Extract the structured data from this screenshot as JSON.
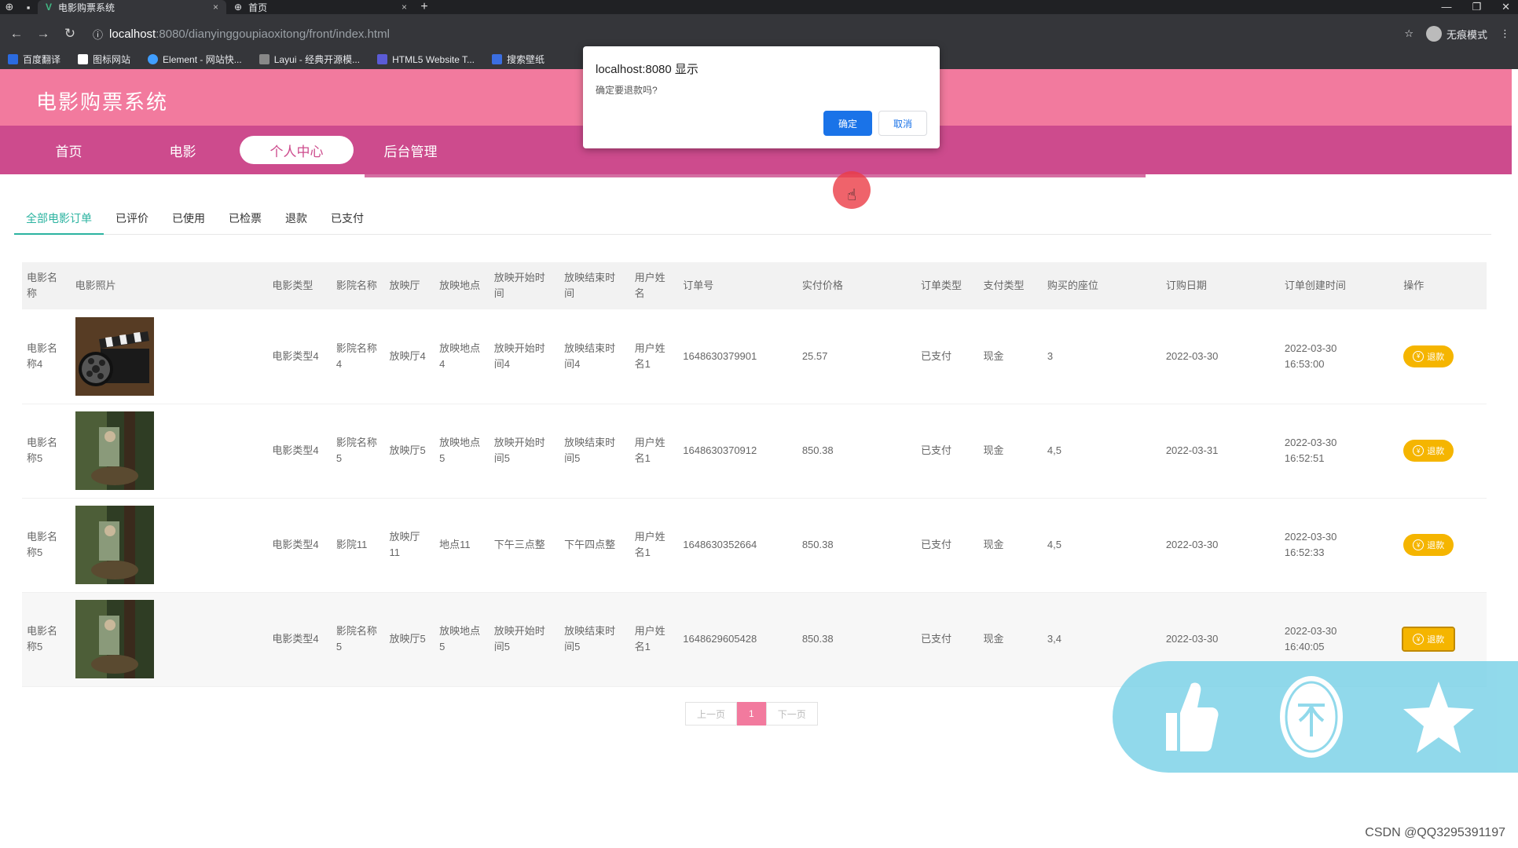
{
  "browser": {
    "tabs": [
      {
        "title": "电影购票系统",
        "close": "×"
      },
      {
        "title": "首页",
        "close": "×"
      }
    ],
    "new_tab": "+",
    "url_host": "localhost",
    "url_path": ":8080/dianyinggoupiaoxitong/front/index.html",
    "incognito_label": "无痕模式",
    "bookmarks": [
      {
        "label": "百度翻译",
        "color": "#2b6be0"
      },
      {
        "label": "图标网站",
        "color": "#ffffff"
      },
      {
        "label": "Element - 网站快...",
        "color": "#409eff"
      },
      {
        "label": "Layui - 经典开源模...",
        "color": "#888888"
      },
      {
        "label": "HTML5 Website T...",
        "color": "#5b5bd6"
      },
      {
        "label": "搜索壁纸",
        "color": "#3b6ee0"
      }
    ]
  },
  "site": {
    "title": "电影购票系统",
    "nav": [
      "首页",
      "电影",
      "个人中心",
      "后台管理"
    ],
    "active_nav": 2
  },
  "order_tabs": [
    "全部电影订单",
    "已评价",
    "已使用",
    "已检票",
    "退款",
    "已支付"
  ],
  "table": {
    "headers": [
      "电影名称",
      "电影照片",
      "电影类型",
      "影院名称",
      "放映厅",
      "放映地点",
      "放映开始时间",
      "放映结束时间",
      "用户姓名",
      "订单号",
      "实付价格",
      "订单类型",
      "支付类型",
      "购买的座位",
      "订购日期",
      "订单创建时间",
      "操作"
    ],
    "rows": [
      {
        "name": "电影名称4",
        "type": "电影类型4",
        "cinema": "影院名称4",
        "hall": "放映厅4",
        "place": "放映地点4",
        "start": "放映开始时间4",
        "end": "放映结束时间4",
        "user": "用户姓名1",
        "order_no": "1648630379901",
        "price": "25.57",
        "order_type": "已支付",
        "pay_type": "现金",
        "seats": "3",
        "date": "2022-03-30",
        "created": "2022-03-30 16:53:00",
        "action": "退款"
      },
      {
        "name": "电影名称5",
        "type": "电影类型4",
        "cinema": "影院名称5",
        "hall": "放映厅5",
        "place": "放映地点5",
        "start": "放映开始时间5",
        "end": "放映结束时间5",
        "user": "用户姓名1",
        "order_no": "1648630370912",
        "price": "850.38",
        "order_type": "已支付",
        "pay_type": "现金",
        "seats": "4,5",
        "date": "2022-03-31",
        "created": "2022-03-30 16:52:51",
        "action": "退款"
      },
      {
        "name": "电影名称5",
        "type": "电影类型4",
        "cinema": "影院11",
        "hall": "放映厅11",
        "place": "地点11",
        "start": "下午三点整",
        "end": "下午四点整",
        "user": "用户姓名1",
        "order_no": "1648630352664",
        "price": "850.38",
        "order_type": "已支付",
        "pay_type": "现金",
        "seats": "4,5",
        "date": "2022-03-30",
        "created": "2022-03-30 16:52:33",
        "action": "退款"
      },
      {
        "name": "电影名称5",
        "type": "电影类型4",
        "cinema": "影院名称5",
        "hall": "放映厅5",
        "place": "放映地点5",
        "start": "放映开始时间5",
        "end": "放映结束时间5",
        "user": "用户姓名1",
        "order_no": "1648629605428",
        "price": "850.38",
        "order_type": "已支付",
        "pay_type": "现金",
        "seats": "3,4",
        "date": "2022-03-30",
        "created": "2022-03-30 16:40:05",
        "action": "退款"
      }
    ]
  },
  "pagination": {
    "prev": "上一页",
    "current": "1",
    "next": "下一页"
  },
  "dialog": {
    "title": "localhost:8080 显示",
    "message": "确定要退款吗?",
    "ok": "确定",
    "cancel": "取消"
  },
  "floating_toolbar": {
    "icons": [
      "thumbs-up-icon",
      "coin-icon",
      "star-icon"
    ]
  },
  "watermark": "CSDN @QQ3295391197",
  "colors": {
    "header_pink": "#f27a9e",
    "nav_magenta": "#cd4b8d",
    "tab_active": "#2bb3a0",
    "refund_btn": "#f5b500",
    "dialog_ok": "#1a73e8"
  }
}
